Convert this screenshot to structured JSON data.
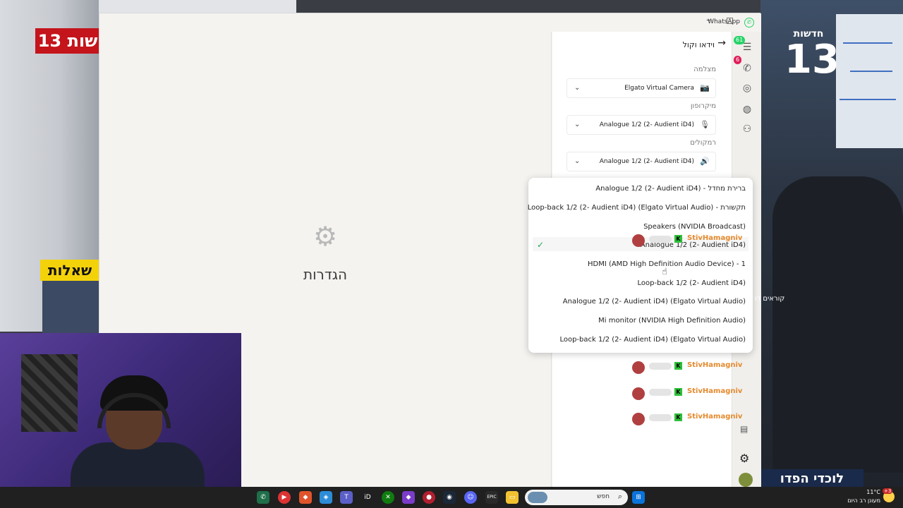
{
  "stream": {
    "news_logo_left": "שות 13",
    "question_banner": "שאלות",
    "news13_small": "חדשות",
    "news13_big": "13",
    "ticker_right": "לוכדי הפדו",
    "side_text": "קוראים דו"
  },
  "window": {
    "app_name": "WhatsApp",
    "minimize": "–"
  },
  "main": {
    "title": "הגדרות",
    "gear_icon": "gear-icon"
  },
  "rail": {
    "chats_badge": "61",
    "calls_badge": "6"
  },
  "settings": {
    "header": "וידאו וקול",
    "camera_label": "מצלמה",
    "camera_value": "Elgato Virtual Camera",
    "mic_label": "מיקרופון",
    "mic_value": "Analogue 1/2 (2- Audient iD4)",
    "speakers_label": "רמקולים",
    "speakers_value": "Analogue 1/2 (2- Audient iD4)"
  },
  "dropdown": {
    "options": [
      "Analogue 1/2 (2- Audient iD4) - ברירת מחדל",
      "Loop-back 1/2 (2- Audient iD4) (Elgato Virtual Audio) - תקשורת",
      "Speakers (NVIDIA Broadcast)",
      "Analogue 1/2 (2- Audient iD4)",
      "HDMI (AMD High Definition Audio Device) - 1",
      "Loop-back 1/2 (2- Audient iD4)",
      "Analogue 1/2 (2- Audient iD4) (Elgato Virtual Audio)",
      "Mi monitor (NVIDIA High Definition Audio)",
      "Loop-back 1/2 (2- Audient iD4) (Elgato Virtual Audio)"
    ],
    "selected_index": 3
  },
  "chat_overlay": {
    "username": "StivHamagniv",
    "k_badge": "K"
  },
  "taskbar": {
    "search_placeholder": "חפש",
    "weather_temp": "11°C",
    "weather_desc": "מעונן רב היום",
    "notif_count": "+3",
    "id_label": "iD",
    "epic_label": "EPIC"
  }
}
